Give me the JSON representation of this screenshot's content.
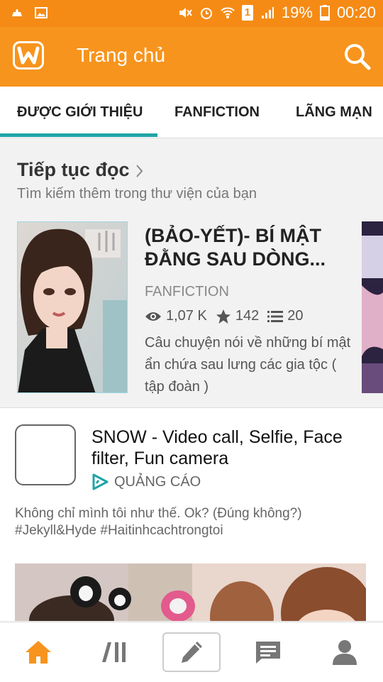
{
  "status_bar": {
    "battery": "19%",
    "time": "00:20",
    "sim_slot": "1",
    "icons": [
      "notification-icon",
      "gallery-icon",
      "mute-icon",
      "alarm-icon",
      "wifi-icon",
      "sim-icon",
      "signal-icon",
      "battery-icon"
    ]
  },
  "header": {
    "title": "Trang chủ",
    "logo_letter": "W",
    "brand_color": "#f7941d"
  },
  "tabs": [
    {
      "label": "ĐƯỢC GIỚI THIỆU",
      "active": true
    },
    {
      "label": "FANFICTION",
      "active": false
    },
    {
      "label": "LÃNG MẠN",
      "active": false
    }
  ],
  "accent_color": "#1fa4a8",
  "continue_reading": {
    "heading": "Tiếp tục đọc",
    "subtitle": "Tìm kiếm thêm trong thư viện của bạn",
    "story": {
      "title": "(BẢO-YẾT)- BÍ MẬT ĐẰNG SAU DÒNG...",
      "category": "FANFICTION",
      "reads": "1,07 K",
      "votes": "142",
      "parts": "20",
      "description": "Câu chuyện nói về những bí mật ẩn chứa sau lưng các gia tộc ( tập đoàn )"
    }
  },
  "ad": {
    "title": "SNOW - Video call, Selfie, Face filter, Fun camera",
    "label": "QUẢNG CÁO",
    "text": "Không chỉ mình tôi như thế. Ok? (Đúng không?) #Jekyll&Hyde #Haitinhcachtrongtoi"
  },
  "bottom_nav": [
    "home-icon",
    "library-icon",
    "write-icon",
    "messages-icon",
    "profile-icon"
  ]
}
